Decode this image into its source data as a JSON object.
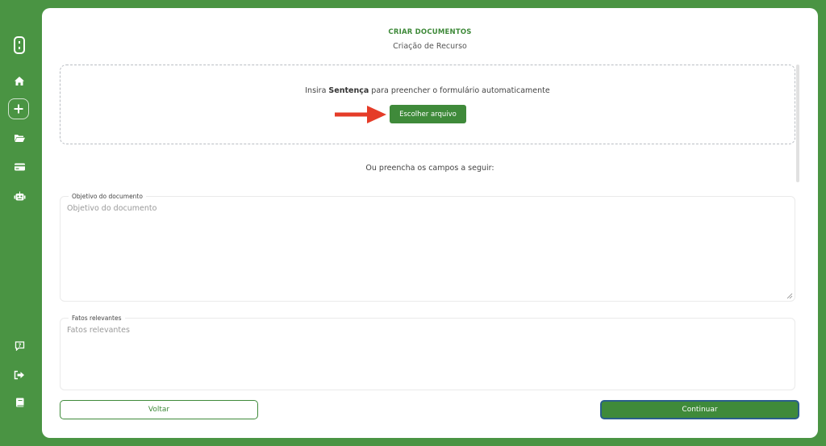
{
  "sidebar": {
    "items": [
      {
        "icon": "logo-icon"
      },
      {
        "icon": "home-icon"
      },
      {
        "icon": "plus-icon"
      },
      {
        "icon": "folder-open-icon"
      },
      {
        "icon": "credit-card-icon"
      },
      {
        "icon": "robot-icon"
      },
      {
        "icon": "help-icon"
      },
      {
        "icon": "logout-icon"
      },
      {
        "icon": "book-icon"
      }
    ]
  },
  "header": {
    "title": "CRIAR DOCUMENTOS",
    "subtitle": "Criação de Recurso"
  },
  "upload": {
    "text_prefix": "Insira ",
    "text_bold": "Sentença",
    "text_suffix": " para preencher o formulário automaticamente",
    "button_label": "Escolher arquivo",
    "arrow_color": "#e53c28"
  },
  "or_text": "Ou preencha os campos a seguir:",
  "fields": {
    "objetivo": {
      "label": "Objetivo do documento",
      "placeholder": "Objetivo do documento"
    },
    "fatos": {
      "label": "Fatos relevantes",
      "placeholder": "Fatos relevantes"
    }
  },
  "footer": {
    "back_label": "Voltar",
    "continue_label": "Continuar"
  },
  "colors": {
    "brand_green": "#4a9443",
    "button_green": "#3f8a3a",
    "focus_border": "#2a5e8c"
  }
}
